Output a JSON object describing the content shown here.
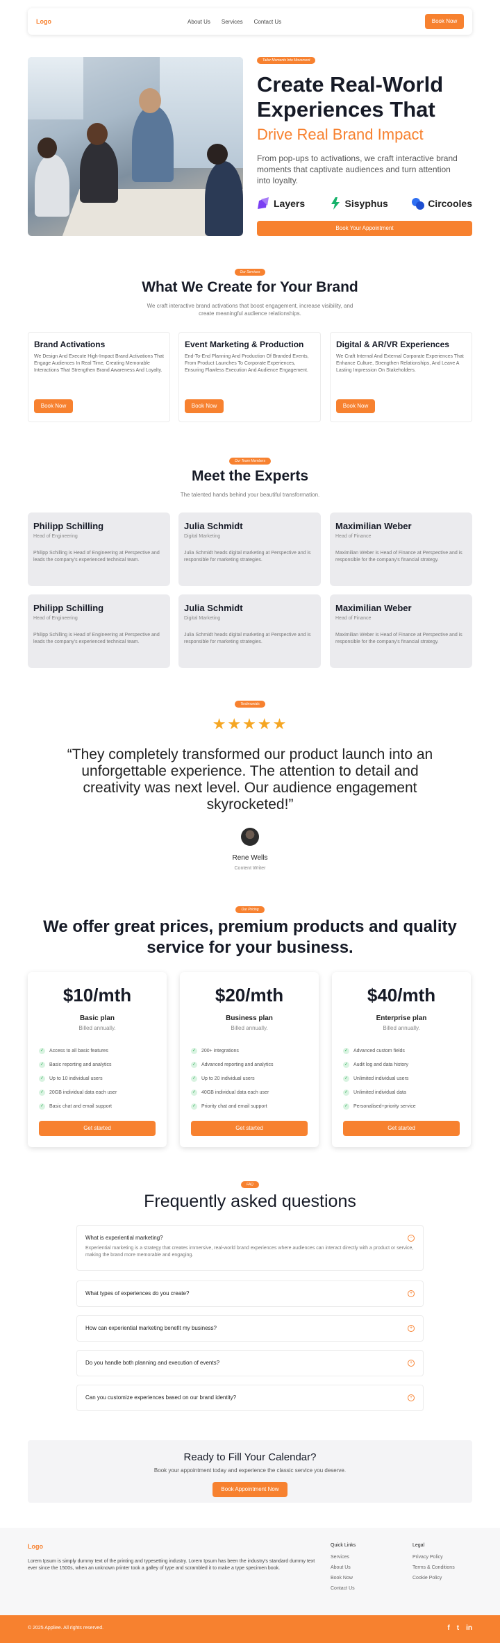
{
  "nav": {
    "logo": "Logo",
    "links": [
      "About Us",
      "Services",
      "Contact Us"
    ],
    "cta": "Book Now"
  },
  "hero": {
    "tag": "Tailor Moments Into Movement",
    "title": "Create Real-World Experiences That",
    "title_accent": "Drive Real Brand Impact",
    "description": "From pop-ups to activations, we craft interactive brand moments that captivate audiences and turn attention into loyalty.",
    "brands": [
      "Layers",
      "Sisyphus",
      "Circooles"
    ],
    "cta": "Book Your Appointment"
  },
  "services": {
    "tag": "Our Services",
    "title": "What We Create for Your Brand",
    "subtitle": "We craft interactive brand activations that boost engagement, increase visibility, and create meaningful audience relationships.",
    "items": [
      {
        "title": "Brand Activations",
        "desc": "We Design And Execute High-Impact Brand Activations That Engage Audiences In Real Time, Creating Memorable Interactions That Strengthen Brand Awareness And Loyalty.",
        "cta": "Book Now"
      },
      {
        "title": "Event Marketing & Production",
        "desc": "End-To-End Planning And Production Of Branded Events, From Product Launches To Corporate Experiences, Ensuring Flawless Execution And Audience Engagement.",
        "cta": "Book Now"
      },
      {
        "title": "Digital & AR/VR Experiences",
        "desc": "We Craft Internal And External Corporate Experiences That Enhance Culture, Strengthen Relationships, And Leave A Lasting Impression On Stakeholders.",
        "cta": "Book Now"
      }
    ]
  },
  "team": {
    "tag": "Our Team Members",
    "title": "Meet the Experts",
    "subtitle": "The talented hands behind your beautiful transformation.",
    "members": [
      {
        "name": "Philipp Schilling",
        "role": "Head of Engineering",
        "bio": "Philipp Schilling is Head of Engineering at Perspective and leads the company's experienced technical team."
      },
      {
        "name": "Julia Schmidt",
        "role": "Digital Marketing",
        "bio": "Julia Schmidt heads digital marketing at Perspective and is responsible for marketing strategies."
      },
      {
        "name": "Maximilian Weber",
        "role": "Head of Finance",
        "bio": "Maximilian Weber is Head of Finance at Perspective and is responsible for the company's financial strategy."
      },
      {
        "name": "Philipp Schilling",
        "role": "Head of Engineering",
        "bio": "Philipp Schilling is Head of Engineering at Perspective and leads the company's experienced technical team."
      },
      {
        "name": "Julia Schmidt",
        "role": "Digital Marketing",
        "bio": "Julia Schmidt heads digital marketing at Perspective and is responsible for marketing strategies."
      },
      {
        "name": "Maximilian Weber",
        "role": "Head of Finance",
        "bio": "Maximilian Weber is Head of Finance at Perspective and is responsible for the company's financial strategy."
      }
    ]
  },
  "testimonial": {
    "tag": "Testimonials",
    "rating": 5,
    "stars": "★★★★★",
    "quote": "“They completely transformed our product launch into an unforgettable experience. The attention to detail and creativity was next level. Our audience engagement skyrocketed!”",
    "name": "Rene Wells",
    "role": "Content Writer"
  },
  "pricing": {
    "tag": "Our Pricing",
    "title": "We offer great prices, premium products and quality service for your business.",
    "plans": [
      {
        "price": "$10/mth",
        "name": "Basic plan",
        "billing": "Billed annually.",
        "features": [
          "Access to all basic features",
          "Basic reporting and analytics",
          "Up to 10 individual users",
          "20GB individual data each user",
          "Basic chat and email support"
        ],
        "cta": "Get started"
      },
      {
        "price": "$20/mth",
        "name": "Business plan",
        "billing": "Billed annually.",
        "features": [
          "200+ integrations",
          "Advanced reporting and analytics",
          "Up to 20 individual users",
          "40GB individual data each user",
          "Priority chat and email support"
        ],
        "cta": "Get started"
      },
      {
        "price": "$40/mth",
        "name": "Enterprise plan",
        "billing": "Billed annually.",
        "features": [
          "Advanced custom fields",
          "Audit log and data history",
          "Unlimited individual users",
          "Unlimited individual data",
          "Personalised+priority service"
        ],
        "cta": "Get started"
      }
    ]
  },
  "faq": {
    "tag": "FAQ",
    "title": "Frequently asked questions",
    "items": [
      {
        "q": "What is experiential marketing?",
        "a": "Experiential marketing is a strategy that creates immersive, real-world brand experiences where audiences can interact directly with a product or service, making the brand more memorable and engaging."
      },
      {
        "q": "What types of experiences do you create?",
        "a": ""
      },
      {
        "q": "How can experiential marketing benefit my business?",
        "a": ""
      },
      {
        "q": "Do you handle both planning and execution of events?",
        "a": ""
      },
      {
        "q": "Can you customize experiences based on our brand identity?",
        "a": ""
      }
    ]
  },
  "cta": {
    "title": "Ready to Fill Your Calendar?",
    "text": "Book your appointment today and experience the classic service you deserve.",
    "button": "Book Appointment Now"
  },
  "footer": {
    "logo": "Logo",
    "description": "Lorem Ipsum is simply dummy text of the printing and typesetting industry. Lorem Ipsum has been the industry's standard dummy text ever since the 1500s, when an unknown printer took a galley of type and scrambled it to make a type specimen book.",
    "quick_links_title": "Quick Links",
    "quick_links": [
      "Services",
      "About Us",
      "Book Now",
      "Contact Us"
    ],
    "legal_title": "Legal",
    "legal": [
      "Privacy Policy",
      "Terms & Conditions",
      "Cookie Policy"
    ],
    "copyright": "© 2025 Appliee. All rights reserved.",
    "social_icons": [
      "facebook-icon",
      "twitter-icon",
      "linkedin-icon"
    ],
    "social_glyphs": [
      "f",
      "t",
      "in"
    ]
  },
  "colors": {
    "accent": "#f7812f",
    "star": "#f5a623",
    "check": "#1fa64b"
  }
}
